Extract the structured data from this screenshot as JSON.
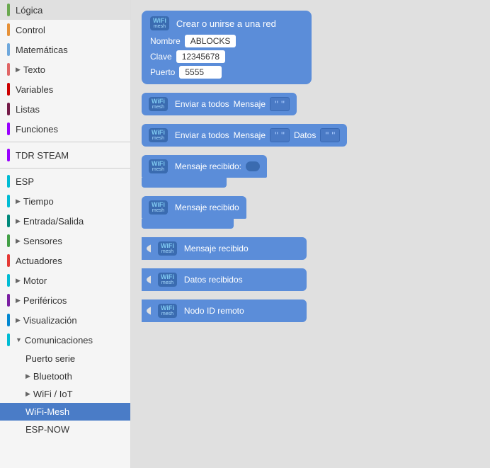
{
  "sidebar": {
    "items": [
      {
        "id": "logica",
        "label": "Lógica",
        "color": "#6aa84f",
        "indent": 0,
        "hasArrow": false,
        "active": false
      },
      {
        "id": "control",
        "label": "Control",
        "color": "#e69138",
        "indent": 0,
        "hasArrow": false,
        "active": false
      },
      {
        "id": "matematicas",
        "label": "Matemáticas",
        "color": "#6fa8dc",
        "indent": 0,
        "hasArrow": false,
        "active": false
      },
      {
        "id": "texto",
        "label": "Texto",
        "color": "#e06666",
        "indent": 0,
        "hasArrow": true,
        "active": false
      },
      {
        "id": "variables",
        "label": "Variables",
        "color": "#cc0000",
        "indent": 0,
        "hasArrow": false,
        "active": false
      },
      {
        "id": "listas",
        "label": "Listas",
        "color": "#741b47",
        "indent": 0,
        "hasArrow": false,
        "active": false
      },
      {
        "id": "funciones",
        "label": "Funciones",
        "color": "#9900ff",
        "indent": 0,
        "hasArrow": false,
        "active": false
      },
      {
        "id": "tdr-steam",
        "label": "TDR STEAM",
        "color": "#9900ff",
        "indent": 0,
        "hasArrow": false,
        "active": false,
        "separator": true
      },
      {
        "id": "esp",
        "label": "ESP",
        "color": "#00bcd4",
        "indent": 0,
        "hasArrow": false,
        "active": false
      },
      {
        "id": "tiempo",
        "label": "Tiempo",
        "color": "#00bcd4",
        "indent": 0,
        "hasArrow": true,
        "active": false
      },
      {
        "id": "entrada-salida",
        "label": "Entrada/Salida",
        "color": "#00897b",
        "indent": 0,
        "hasArrow": true,
        "active": false
      },
      {
        "id": "sensores",
        "label": "Sensores",
        "color": "#43a047",
        "indent": 0,
        "hasArrow": true,
        "active": false
      },
      {
        "id": "actuadores",
        "label": "Actuadores",
        "color": "#e53935",
        "indent": 0,
        "hasArrow": false,
        "active": false
      },
      {
        "id": "motor",
        "label": "Motor",
        "color": "#00bcd4",
        "indent": 0,
        "hasArrow": true,
        "active": false
      },
      {
        "id": "perifericos",
        "label": "Periféricos",
        "color": "#7b1fa2",
        "indent": 0,
        "hasArrow": true,
        "active": false
      },
      {
        "id": "visualizacion",
        "label": "Visualización",
        "color": "#0288d1",
        "indent": 0,
        "hasArrow": true,
        "active": false
      },
      {
        "id": "comunicaciones",
        "label": "Comunicaciones",
        "color": "#00bcd4",
        "indent": 0,
        "hasArrow": true,
        "expanded": true,
        "active": false
      },
      {
        "id": "puerto-serie",
        "label": "Puerto serie",
        "color": "#00bcd4",
        "indent": 1,
        "hasArrow": false,
        "active": false
      },
      {
        "id": "bluetooth",
        "label": "Bluetooth",
        "color": "#00bcd4",
        "indent": 1,
        "hasArrow": true,
        "active": false
      },
      {
        "id": "wifi-iot",
        "label": "WiFi / IoT",
        "color": "#00bcd4",
        "indent": 1,
        "hasArrow": true,
        "active": false
      },
      {
        "id": "wifi-mesh",
        "label": "WiFi-Mesh",
        "color": "#00bcd4",
        "indent": 1,
        "hasArrow": false,
        "active": true
      },
      {
        "id": "esp-now",
        "label": "ESP-NOW",
        "color": "#00bcd4",
        "indent": 1,
        "hasArrow": false,
        "active": false
      }
    ]
  },
  "blocks": [
    {
      "id": "block1",
      "type": "create-network",
      "title": "Crear o unirse a una red",
      "fields": [
        {
          "label": "Nombre",
          "value": "ABLOCKS"
        },
        {
          "label": "Clave",
          "value": "12345678"
        },
        {
          "label": "Puerto",
          "value": "5555"
        }
      ]
    },
    {
      "id": "block2",
      "type": "send-all-message",
      "text1": "Enviar a todos",
      "text2": "Mensaje",
      "hasStringInput": true
    },
    {
      "id": "block3",
      "type": "send-all-message-data",
      "text1": "Enviar a todos",
      "text2": "Mensaje",
      "text3": "Datos",
      "hasStringInput1": true,
      "hasStringInput2": true
    },
    {
      "id": "block4",
      "type": "message-received-bool",
      "text": "Mensaje recibido:",
      "hasBoolOutput": true,
      "hasBottomExt": true
    },
    {
      "id": "block5",
      "type": "message-received",
      "text": "Mensaje recibido",
      "hasBottomExt": true
    },
    {
      "id": "block6",
      "type": "message-received-notch",
      "text": "Mensaje recibido",
      "hasLeftNotch": true
    },
    {
      "id": "block7",
      "type": "data-received",
      "text": "Datos recibidos",
      "hasLeftNotch": true
    },
    {
      "id": "block8",
      "type": "remote-node-id",
      "text": "Nodo ID remoto",
      "hasLeftNotch": true
    }
  ],
  "wifi_logo": {
    "top": "WiFi",
    "bottom": "mesh"
  }
}
